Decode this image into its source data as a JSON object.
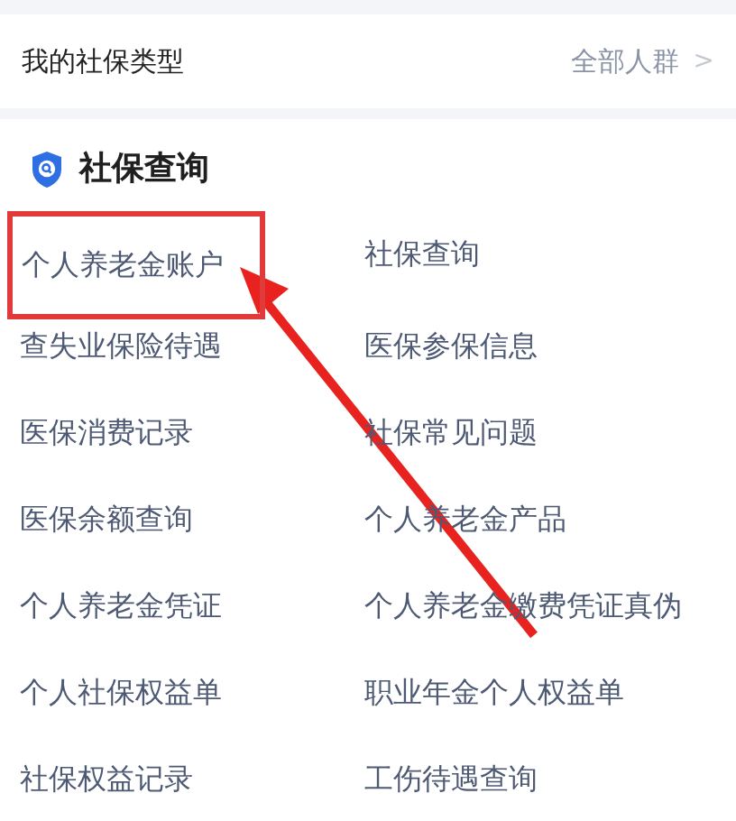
{
  "header": {
    "title": "我的社保类型",
    "link": "全部人群",
    "chevron": ">"
  },
  "section": {
    "title": "社保查询",
    "items": [
      {
        "label": "个人养老金账户",
        "highlighted": true
      },
      {
        "label": "社保查询",
        "highlighted": false
      },
      {
        "label": "查失业保险待遇",
        "highlighted": false
      },
      {
        "label": "医保参保信息",
        "highlighted": false
      },
      {
        "label": "医保消费记录",
        "highlighted": false
      },
      {
        "label": "社保常见问题",
        "highlighted": false
      },
      {
        "label": "医保余额查询",
        "highlighted": false
      },
      {
        "label": "个人养老金产品",
        "highlighted": false
      },
      {
        "label": "个人养老金凭证",
        "highlighted": false
      },
      {
        "label": "个人养老金缴费凭证真伪",
        "highlighted": false
      },
      {
        "label": "个人社保权益单",
        "highlighted": false
      },
      {
        "label": "职业年金个人权益单",
        "highlighted": false
      },
      {
        "label": "社保权益记录",
        "highlighted": false
      },
      {
        "label": "工伤待遇查询",
        "highlighted": false
      }
    ]
  }
}
